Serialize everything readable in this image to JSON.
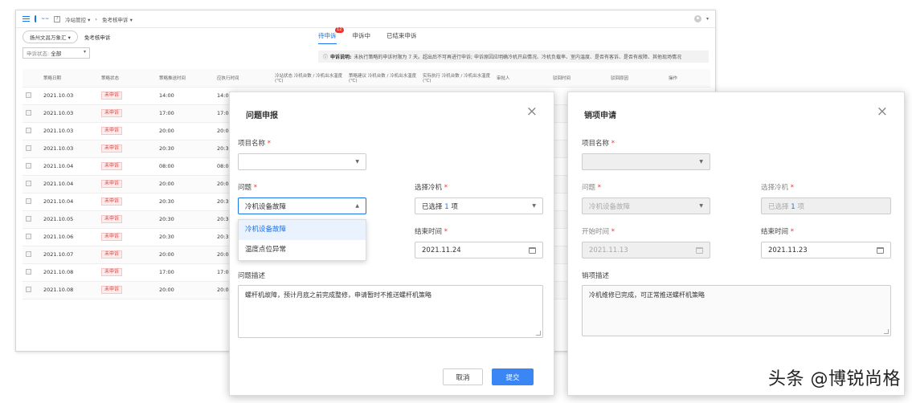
{
  "app": {
    "breadcrumbs": [
      "冷站管控",
      "免考核申诉"
    ],
    "station": "扬州文昌万象汇",
    "page_label": "免考核申诉",
    "tabs": [
      {
        "label": "待申诉",
        "badge": "12"
      },
      {
        "label": "申诉中"
      },
      {
        "label": "已结束申诉"
      }
    ],
    "filter": {
      "label": "申诉状态:",
      "value": "全部"
    },
    "notice": {
      "title": "申诉说明:",
      "text": "未执行策略的申诉时限为 7 天。超出后不可再进行申诉; 申诉原因应明确冷机开启情况、冷机负载率、室内温度、是否有客诉、是否有故障、其他现场情况"
    },
    "table": {
      "headers": [
        "策略日期",
        "策略状态",
        "策略推送时间",
        "应执行时间",
        "冷站状态 冷机台数 / 冷机出水温度(℃)",
        "策略建议 冷机台数 / 冷机出水温度(℃)",
        "实际执行 冷机台数 / 冷机出水温度(℃)",
        "审批人",
        "驳回时间",
        "驳回原因",
        "操作"
      ],
      "rows": [
        {
          "date": "2021.10.03",
          "status": "未申诉",
          "push": "14:00",
          "exec": "14:0"
        },
        {
          "date": "2021.10.03",
          "status": "未申诉",
          "push": "17:00",
          "exec": "17:0"
        },
        {
          "date": "2021.10.03",
          "status": "未申诉",
          "push": "20:00",
          "exec": "20:0"
        },
        {
          "date": "2021.10.03",
          "status": "未申诉",
          "push": "20:30",
          "exec": "20:3"
        },
        {
          "date": "2021.10.04",
          "status": "未申诉",
          "push": "08:00",
          "exec": "08:0"
        },
        {
          "date": "2021.10.04",
          "status": "未申诉",
          "push": "20:00",
          "exec": "20:0"
        },
        {
          "date": "2021.10.04",
          "status": "未申诉",
          "push": "20:30",
          "exec": "20:3"
        },
        {
          "date": "2021.10.05",
          "status": "未申诉",
          "push": "20:30",
          "exec": "20:3"
        },
        {
          "date": "2021.10.06",
          "status": "未申诉",
          "push": "20:30",
          "exec": "20:3"
        },
        {
          "date": "2021.10.07",
          "status": "未申诉",
          "push": "20:00",
          "exec": "20:0"
        },
        {
          "date": "2021.10.08",
          "status": "未申诉",
          "push": "17:00",
          "exec": "17:0"
        },
        {
          "date": "2021.10.08",
          "status": "未申诉",
          "push": "20:00",
          "exec": "20:0"
        }
      ]
    }
  },
  "report_modal": {
    "title": "问题申报",
    "project_label": "项目名称",
    "project_value": "",
    "issue_label": "问题",
    "issue_value": "冷机设备故障",
    "issue_options": [
      "冷机设备故障",
      "温度点位异常"
    ],
    "chiller_label": "选择冷机",
    "chiller_prefix": "已选择",
    "chiller_count": "1",
    "chiller_suffix": "项",
    "end_label": "结束时间",
    "end_value": "2021.11.24",
    "desc_label": "问题描述",
    "desc_value": "螺杆机故障，预计月底之前完成整修，申请暂时不推送螺杆机策略",
    "cancel_label": "取消",
    "submit_label": "提交"
  },
  "close_modal": {
    "title": "销项申请",
    "project_label": "项目名称",
    "issue_label": "问题",
    "issue_value": "冷机设备故障",
    "chiller_label": "选择冷机",
    "chiller_prefix": "已选择",
    "chiller_count": "1",
    "chiller_suffix": "项",
    "start_label": "开始时间",
    "start_value": "2021.11.13",
    "end_label": "结束时间",
    "end_value": "2021.11.23",
    "desc_label": "销项描述",
    "desc_value": "冷机维修已完成，可正常推送螺杆机策略"
  },
  "watermark": "头条 @博锐尚格",
  "colors": {
    "accent": "#1a73e8",
    "danger": "#e53935",
    "submit": "#3a86f5"
  }
}
